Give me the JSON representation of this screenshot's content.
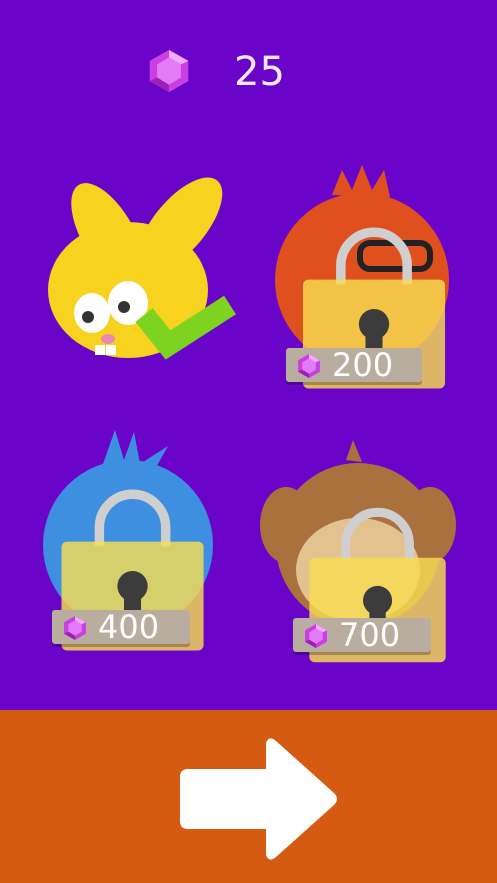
{
  "header": {
    "gem_count": "25",
    "gem_icon": "purple-gem-icon"
  },
  "characters": [
    {
      "name_icon": "yellow-bunny",
      "status": "selected",
      "price": null
    },
    {
      "name_icon": "orange-furry-with-glasses",
      "status": "locked",
      "price": "200"
    },
    {
      "name_icon": "blue-bird",
      "status": "locked",
      "price": "400"
    },
    {
      "name_icon": "brown-monkey",
      "status": "locked",
      "price": "700"
    }
  ],
  "footer": {
    "next_icon": "right-arrow-icon"
  },
  "colors": {
    "background": "#6a04c8",
    "footer": "#d65b12",
    "gem": "#d24be8",
    "lock": "#f4d24c",
    "check": "#7ed321"
  }
}
